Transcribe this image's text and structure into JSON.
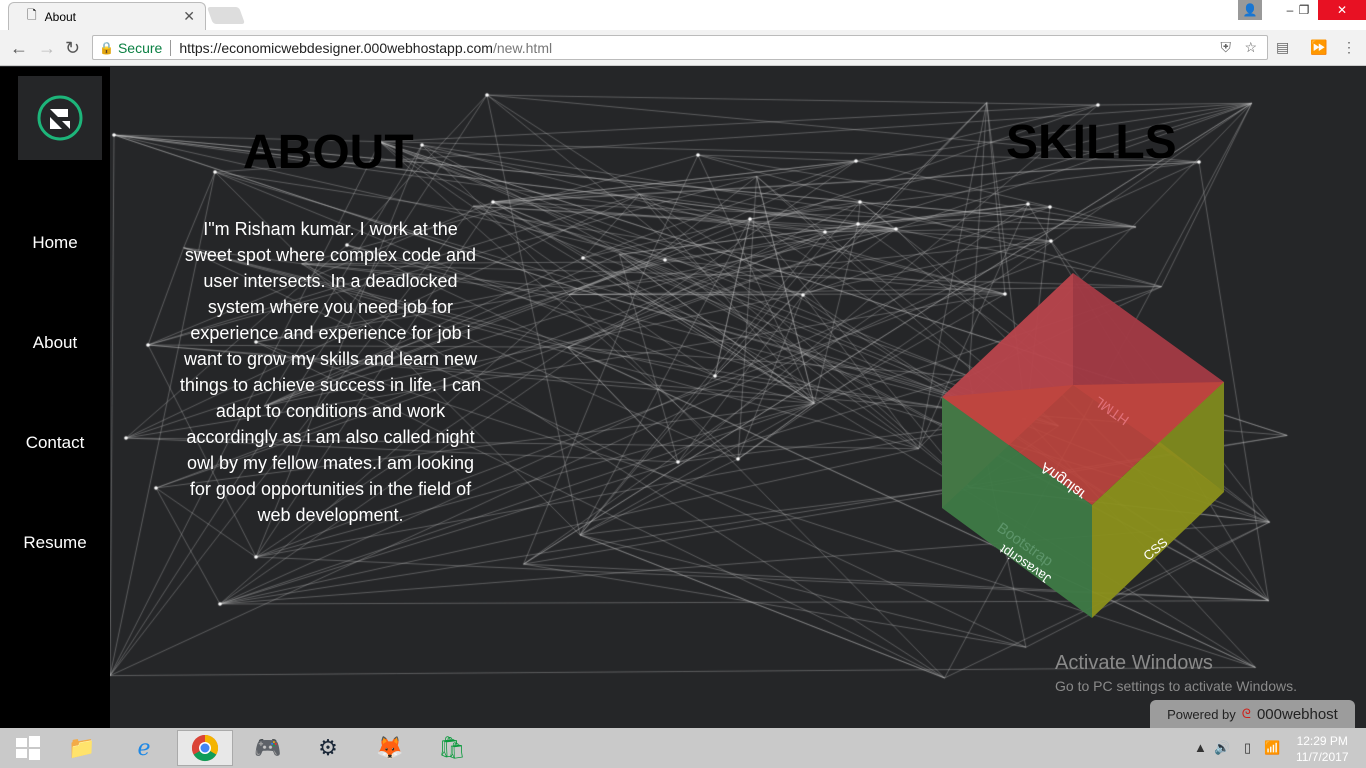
{
  "browser": {
    "tab_title": "About",
    "secure_label": "Secure",
    "url_host": "https://economicwebdesigner.000webhostapp.com",
    "url_path": "/new.html"
  },
  "sidebar": {
    "items": [
      {
        "label": "Home"
      },
      {
        "label": "About"
      },
      {
        "label": "Contact"
      },
      {
        "label": "Resume"
      }
    ]
  },
  "about": {
    "title": "ABOUT",
    "text": "I\"m Risham kumar. I work at the sweet spot where complex code and user intersects. In a deadlocked system where you need job for experience and experience for job i want to grow my skills and learn new things to achieve success in life. I can adapt to conditions and work accordingly as i am also called night owl by my fellow mates.I am looking for good opportunities in the field of web development."
  },
  "skills": {
    "title": "SKILLS",
    "faces": [
      "Angular",
      "HTML",
      "Javascript",
      "CSS",
      "Bootstrap"
    ],
    "colors": {
      "red": "#c0464a",
      "green": "#3e7a46",
      "yellow": "#8b901b"
    }
  },
  "watermark": {
    "line1": "Activate Windows",
    "line2": "Go to PC settings to activate Windows."
  },
  "powered": {
    "label": "Powered by",
    "brand": "000webhost"
  },
  "taskbar": {
    "time": "12:29 PM",
    "date": "11/7/2017"
  }
}
